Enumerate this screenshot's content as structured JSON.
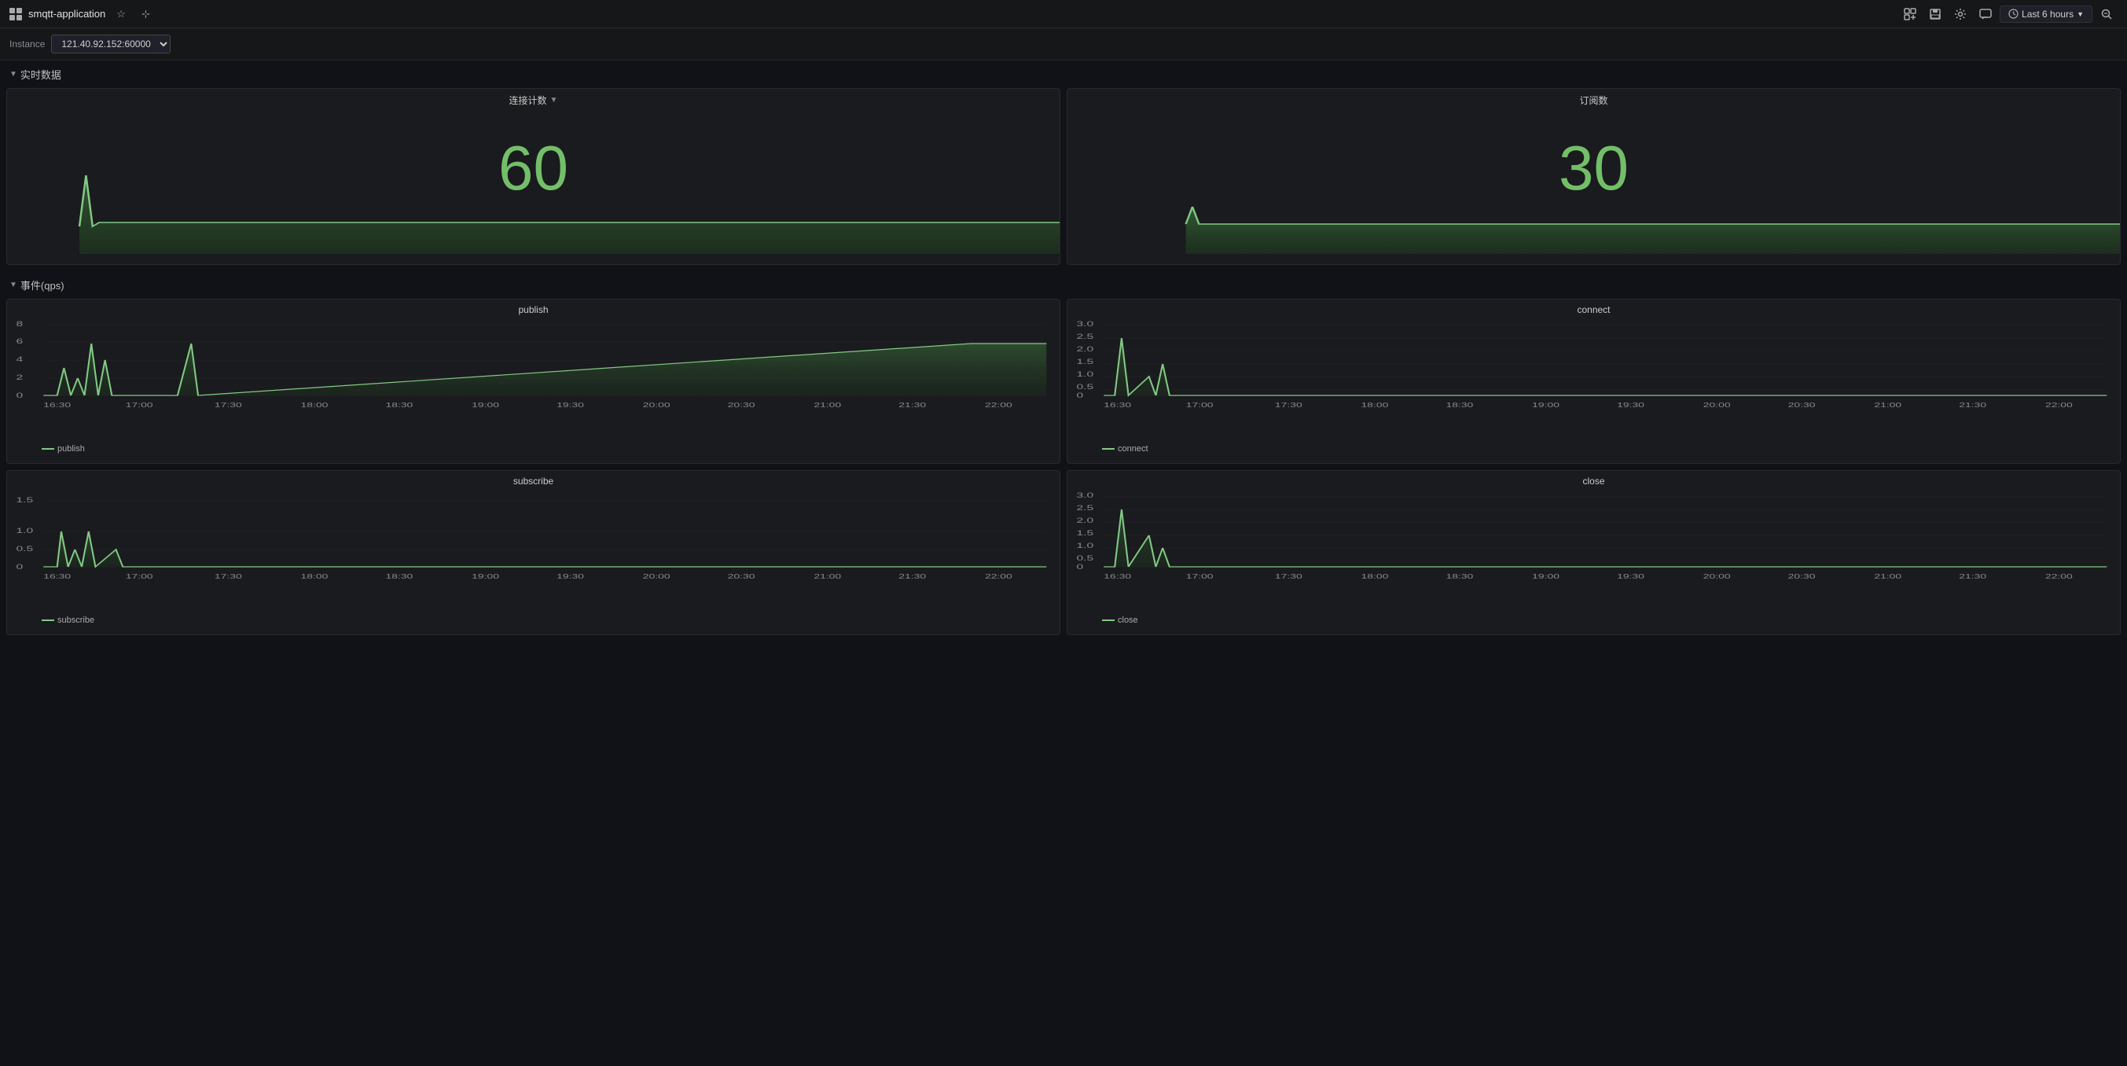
{
  "topbar": {
    "app_icon": "grid-icon",
    "app_title": "smqtt-application",
    "star_icon": "★",
    "share_icon": "⊹",
    "add_panel_icon": "📊",
    "save_icon": "💾",
    "settings_icon": "⚙",
    "comment_icon": "💬",
    "time_range": "Last 6 hours",
    "zoom_icon": "🔍"
  },
  "filterbar": {
    "label": "Instance",
    "value": "121.40.92.152:60000"
  },
  "sections": {
    "realtime": "实时数据",
    "events": "事件(qps)"
  },
  "panels": {
    "connections": {
      "title": "连接计数",
      "value": "60",
      "has_chevron": true
    },
    "subscriptions": {
      "title": "订阅数",
      "value": "30"
    },
    "publish": {
      "title": "publish",
      "y_max": "8",
      "y_mid": "6",
      "y_2": "4",
      "y_1": "2",
      "y_0": "0",
      "legend": "publish",
      "times": [
        "16:30",
        "17:00",
        "17:30",
        "18:00",
        "18:30",
        "19:00",
        "19:30",
        "20:00",
        "20:30",
        "21:00",
        "21:30",
        "22:00"
      ]
    },
    "connect": {
      "title": "connect",
      "y_max": "3.0",
      "y_2_5": "2.5",
      "y_2": "2.0",
      "y_1_5": "1.5",
      "y_1": "1.0",
      "y_0_5": "0.5",
      "y_0": "0",
      "legend": "connect",
      "times": [
        "16:30",
        "17:00",
        "17:30",
        "18:00",
        "18:30",
        "19:00",
        "19:30",
        "20:00",
        "20:30",
        "21:00",
        "21:30",
        "22:00"
      ]
    },
    "subscribe": {
      "title": "subscribe",
      "y_max": "1.5",
      "y_1": "1.0",
      "y_0_5": "0.5",
      "y_0": "0",
      "legend": "subscribe",
      "times": [
        "16:30",
        "17:00",
        "17:30",
        "18:00",
        "18:30",
        "19:00",
        "19:30",
        "20:00",
        "20:30",
        "21:00",
        "21:30",
        "22:00"
      ]
    },
    "close": {
      "title": "close",
      "y_max": "3.0",
      "y_2_5": "2.5",
      "y_2": "2.0",
      "y_1_5": "1.5",
      "y_1": "1.0",
      "y_0_5": "0.5",
      "y_0": "0",
      "legend": "close",
      "times": [
        "16:30",
        "17:00",
        "17:30",
        "18:00",
        "18:30",
        "19:00",
        "19:30",
        "20:00",
        "20:30",
        "21:00",
        "21:30",
        "22:00"
      ]
    }
  },
  "colors": {
    "accent_green": "#73bf69",
    "chart_fill": "#2d4a2d",
    "chart_line": "#82c983",
    "bg_dark": "#111217",
    "bg_panel": "#1a1b1e"
  }
}
